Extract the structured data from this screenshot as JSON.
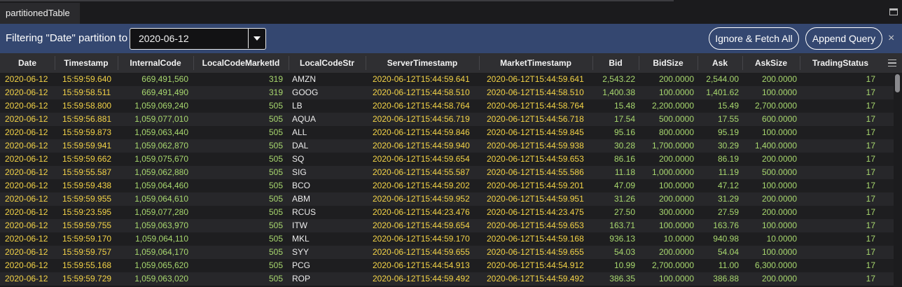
{
  "tab": {
    "title": "partitionedTable"
  },
  "filter": {
    "label": "Filtering \"Date\" partition to",
    "selected_value": "2020-06-12",
    "ignore_button": "Ignore & Fetch All",
    "append_button": "Append Query",
    "close_glyph": "×"
  },
  "columns": [
    "Date",
    "Timestamp",
    "InternalCode",
    "LocalCodeMarketId",
    "LocalCodeStr",
    "ServerTimestamp",
    "MarketTimestamp",
    "Bid",
    "BidSize",
    "Ask",
    "AskSize",
    "TradingStatus"
  ],
  "rows": [
    [
      "2020-06-12",
      "15:59:59.640",
      "669,491,560",
      "319",
      "AMZN",
      "2020-06-12T15:44:59.641",
      "2020-06-12T15:44:59.641",
      "2,543.22",
      "200.0000",
      "2,544.00",
      "200.0000",
      "17"
    ],
    [
      "2020-06-12",
      "15:59:58.511",
      "669,491,490",
      "319",
      "GOOG",
      "2020-06-12T15:44:58.510",
      "2020-06-12T15:44:58.510",
      "1,400.38",
      "100.0000",
      "1,401.62",
      "100.0000",
      "17"
    ],
    [
      "2020-06-12",
      "15:59:58.800",
      "1,059,069,240",
      "505",
      "LB",
      "2020-06-12T15:44:58.764",
      "2020-06-12T15:44:58.764",
      "15.48",
      "2,200.0000",
      "15.49",
      "2,700.0000",
      "17"
    ],
    [
      "2020-06-12",
      "15:59:56.881",
      "1,059,077,010",
      "505",
      "AQUA",
      "2020-06-12T15:44:56.719",
      "2020-06-12T15:44:56.718",
      "17.54",
      "500.0000",
      "17.55",
      "600.0000",
      "17"
    ],
    [
      "2020-06-12",
      "15:59:59.873",
      "1,059,063,440",
      "505",
      "ALL",
      "2020-06-12T15:44:59.846",
      "2020-06-12T15:44:59.845",
      "95.16",
      "800.0000",
      "95.19",
      "100.0000",
      "17"
    ],
    [
      "2020-06-12",
      "15:59:59.941",
      "1,059,062,870",
      "505",
      "DAL",
      "2020-06-12T15:44:59.940",
      "2020-06-12T15:44:59.938",
      "30.28",
      "1,700.0000",
      "30.29",
      "1,400.0000",
      "17"
    ],
    [
      "2020-06-12",
      "15:59:59.662",
      "1,059,075,670",
      "505",
      "SQ",
      "2020-06-12T15:44:59.654",
      "2020-06-12T15:44:59.653",
      "86.16",
      "200.0000",
      "86.19",
      "200.0000",
      "17"
    ],
    [
      "2020-06-12",
      "15:59:55.587",
      "1,059,062,880",
      "505",
      "SIG",
      "2020-06-12T15:44:55.587",
      "2020-06-12T15:44:55.586",
      "11.18",
      "1,000.0000",
      "11.19",
      "500.0000",
      "17"
    ],
    [
      "2020-06-12",
      "15:59:59.438",
      "1,059,064,460",
      "505",
      "BCO",
      "2020-06-12T15:44:59.202",
      "2020-06-12T15:44:59.201",
      "47.09",
      "100.0000",
      "47.12",
      "100.0000",
      "17"
    ],
    [
      "2020-06-12",
      "15:59:59.955",
      "1,059,064,610",
      "505",
      "ABM",
      "2020-06-12T15:44:59.952",
      "2020-06-12T15:44:59.951",
      "31.26",
      "200.0000",
      "31.29",
      "200.0000",
      "17"
    ],
    [
      "2020-06-12",
      "15:59:23.595",
      "1,059,077,280",
      "505",
      "RCUS",
      "2020-06-12T15:44:23.476",
      "2020-06-12T15:44:23.475",
      "27.50",
      "300.0000",
      "27.59",
      "200.0000",
      "17"
    ],
    [
      "2020-06-12",
      "15:59:59.755",
      "1,059,063,970",
      "505",
      "ITW",
      "2020-06-12T15:44:59.654",
      "2020-06-12T15:44:59.653",
      "163.71",
      "100.0000",
      "163.76",
      "100.0000",
      "17"
    ],
    [
      "2020-06-12",
      "15:59:59.170",
      "1,059,064,110",
      "505",
      "MKL",
      "2020-06-12T15:44:59.170",
      "2020-06-12T15:44:59.168",
      "936.13",
      "10.0000",
      "940.98",
      "10.0000",
      "17"
    ],
    [
      "2020-06-12",
      "15:59:59.757",
      "1,059,064,170",
      "505",
      "SYY",
      "2020-06-12T15:44:59.655",
      "2020-06-12T15:44:59.655",
      "54.03",
      "200.0000",
      "54.04",
      "100.0000",
      "17"
    ],
    [
      "2020-06-12",
      "15:59:55.168",
      "1,059,065,620",
      "505",
      "PCG",
      "2020-06-12T15:44:54.913",
      "2020-06-12T15:44:54.912",
      "10.99",
      "2,700.0000",
      "11.00",
      "6,300.0000",
      "17"
    ],
    [
      "2020-06-12",
      "15:59:59.729",
      "1,059,063,020",
      "505",
      "ROP",
      "2020-06-12T15:44:59.492",
      "2020-06-12T15:44:59.492",
      "386.35",
      "100.0000",
      "386.88",
      "200.0000",
      "17"
    ]
  ],
  "colors": {
    "accent_bar": "#344770",
    "date_text": "#f4d447",
    "number_text": "#a8d86e"
  }
}
